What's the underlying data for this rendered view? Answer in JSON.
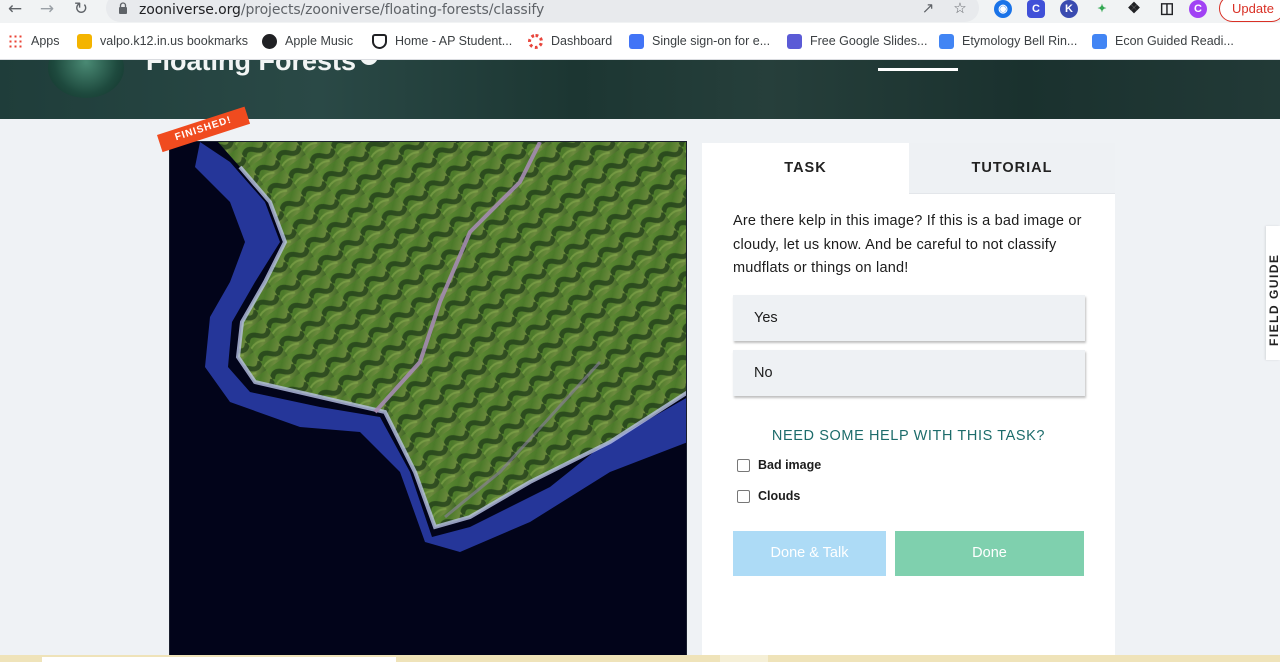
{
  "browser": {
    "url_domain": "zooniverse.org",
    "url_path": "/projects/zooniverse/floating-forests/classify",
    "update_label": "Update",
    "profile_initial": "C",
    "bookmarks": [
      {
        "label": "Apps",
        "icon": "apps-grid-icon",
        "color": "#ea4335"
      },
      {
        "label": "valpo.k12.in.us bookmarks",
        "icon": "folder-icon",
        "color": "#f4b400"
      },
      {
        "label": "Apple Music",
        "icon": "music-icon",
        "color": "#202124"
      },
      {
        "label": "Home - AP Student...",
        "icon": "shield-icon",
        "color": "#202124"
      },
      {
        "label": "Dashboard",
        "icon": "dashboard-icon",
        "color": "#e8453c"
      },
      {
        "label": "Single sign-on for e...",
        "icon": "clever-icon",
        "color": "#4274f6"
      },
      {
        "label": "Free Google Slides...",
        "icon": "slides-icon",
        "color": "#5b5bd6"
      },
      {
        "label": "Etymology Bell Rin...",
        "icon": "docs-icon",
        "color": "#4285f4"
      },
      {
        "label": "Econ Guided Readi...",
        "icon": "docs-icon",
        "color": "#4285f4"
      }
    ]
  },
  "project": {
    "title": "Floating Forests"
  },
  "subject": {
    "status": "FINISHED!"
  },
  "task": {
    "tabs": {
      "task": "TASK",
      "tutorial": "TUTORIAL"
    },
    "question": "Are there kelp in this image? If this is a bad image or cloudy, let us know. And be careful to not classify mudflats or things on land!",
    "answers": {
      "yes": "Yes",
      "no": "No"
    },
    "help_label": "NEED SOME HELP WITH THIS TASK?",
    "checkboxes": {
      "bad_image": "Bad image",
      "clouds": "Clouds"
    },
    "done_talk_label": "Done & Talk",
    "done_label": "Done"
  },
  "field_guide_label": "FIELD GUIDE",
  "colors": {
    "done_button": "#7fd0ae",
    "done_talk_button": "#addbf6",
    "help_link": "#1d6c6b",
    "ribbon": "#f04b1f"
  }
}
